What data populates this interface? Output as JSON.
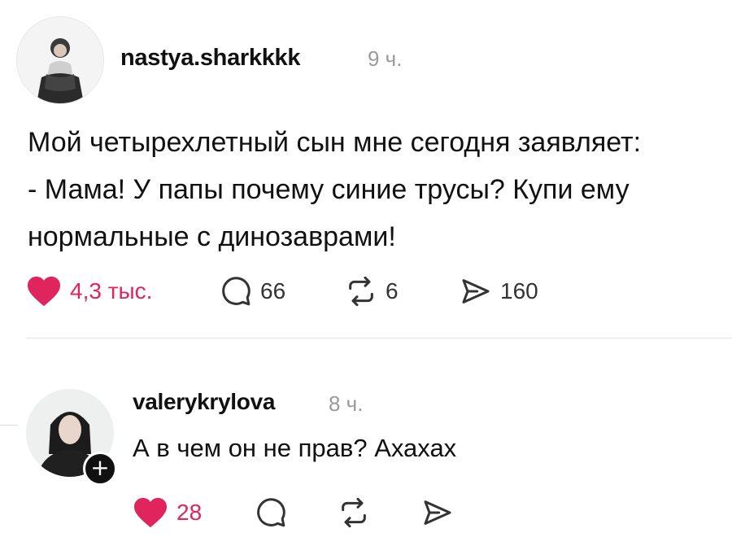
{
  "post": {
    "username": "nastya.sharkkkk",
    "time": "9 ч.",
    "lines": [
      "Мой четырехлетный сын мне сегодня заявляет:",
      "- Мама! У папы почему синие трусы? Купи ему",
      "нормальные с динозаврами!"
    ],
    "likes": "4,3 тыс.",
    "comments": "66",
    "reposts": "6",
    "shares": "160"
  },
  "reply": {
    "username": "valerykrylova",
    "time": "8 ч.",
    "text": "А в чем он не прав? Ахахах",
    "likes": "28"
  },
  "colors": {
    "like_red": "#e0245e",
    "text": "#111111",
    "muted": "#9a9a9a"
  },
  "icons": [
    "heart-filled-icon",
    "comment-bubble-icon",
    "repost-icon",
    "share-send-icon",
    "plus-icon"
  ]
}
